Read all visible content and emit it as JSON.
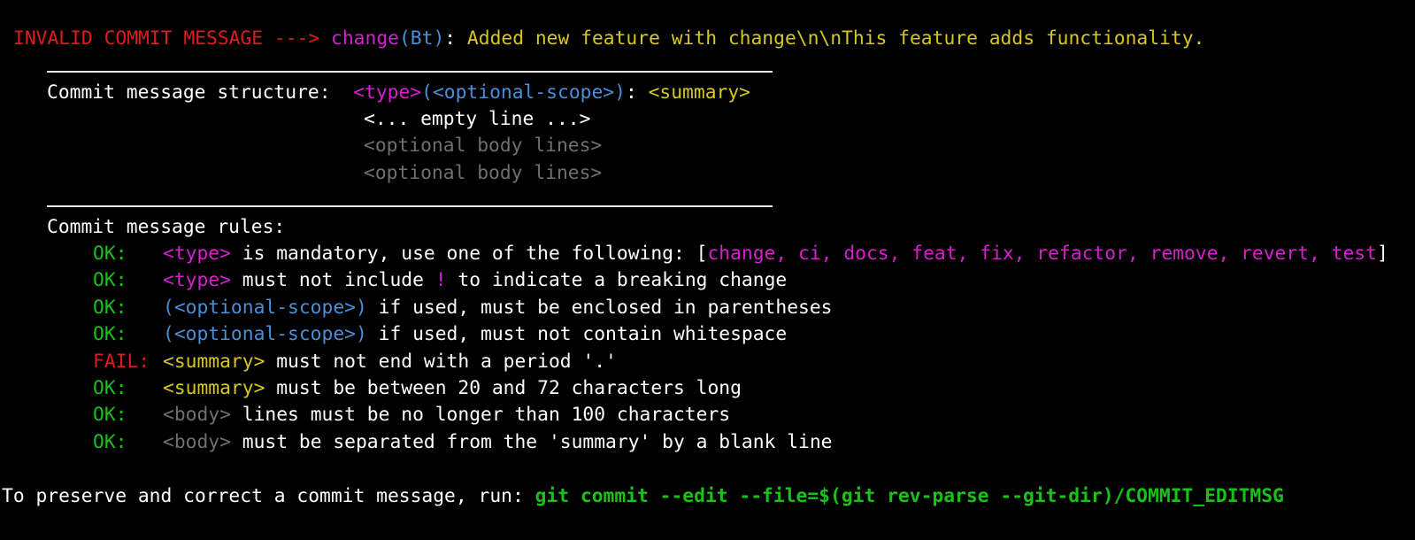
{
  "header": {
    "label": "INVALID COMMIT MESSAGE --->",
    "type": "change",
    "scope_open": "(",
    "scope": "Bt",
    "scope_close": ")",
    "colon": ":",
    "summary": " Added new feature with change\\n\\nThis feature adds functionality."
  },
  "structure": {
    "label": "Commit message structure:",
    "type_token": "<type>",
    "scope_token": "(<optional-scope>)",
    "colon": ":",
    "summary_token": "<summary>",
    "empty_line": "<... empty line ...>",
    "body_line_1": "<optional body lines>",
    "body_line_2": "<optional body lines>"
  },
  "rules": {
    "heading": "Commit message rules:",
    "items": [
      {
        "status": "OK:",
        "token": "<type>",
        "text": " is mandatory, use one of the following: [",
        "types": "change, ci, docs, feat, fix, refactor, remove, revert, test",
        "close": "]"
      },
      {
        "status": "OK:",
        "token": "<type>",
        "text_a": " must not include ",
        "bang": "!",
        "text_b": " to indicate a breaking change"
      },
      {
        "status": "OK:",
        "token": "(<optional-scope>)",
        "text": " if used, must be enclosed in parentheses"
      },
      {
        "status": "OK:",
        "token": "(<optional-scope>)",
        "text": " if used, must not contain whitespace"
      },
      {
        "status": "FAIL:",
        "token": "<summary>",
        "text": " must not end with a period '.'"
      },
      {
        "status": "OK:",
        "token": "<summary>",
        "text": " must be between 20 and 72 characters long"
      },
      {
        "status": "OK:",
        "token": "<body>",
        "text": " lines must be no longer than 100 characters"
      },
      {
        "status": "OK:",
        "token": "<body>",
        "text": " must be separated from the 'summary' by a blank line"
      }
    ]
  },
  "footer": {
    "text": "To preserve and correct a commit message, run: ",
    "command": "git commit --edit --file=$(git rev-parse --git-dir)/COMMIT_EDITMSG"
  },
  "colors": {
    "background": "#000000",
    "error_red": "#e01b1b",
    "type_magenta": "#d61fcf",
    "scope_blue": "#4a8fd6",
    "summary_yellow": "#d6c81a",
    "ok_green": "#19c219",
    "body_grey": "#6f6f6f"
  }
}
